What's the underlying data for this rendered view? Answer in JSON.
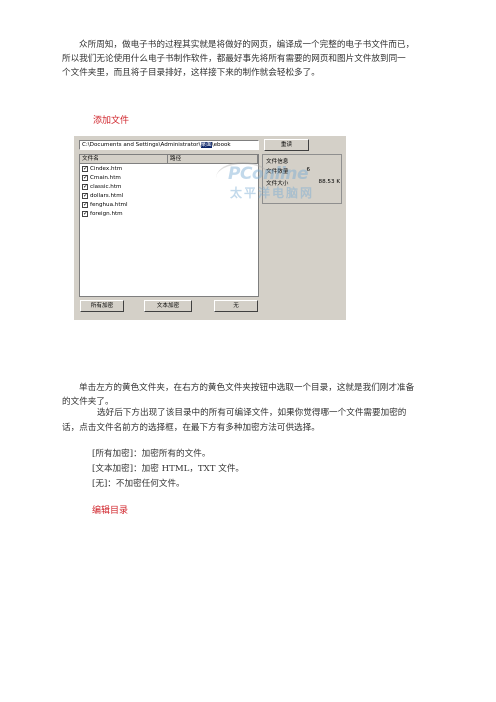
{
  "intro": {
    "lines": [
      "众所周知，做电子书的过程其实就是将做好的网页，编译成一个完整的电子书文件而已，",
      "所以我们无论使用什么电子书制作软件，都最好事先将所有需要的网页和图片文件放到同一",
      "个文件夹里，而且将子目录排好，这样接下来的制作就会轻松多了。"
    ]
  },
  "section1_heading": "添加文件",
  "screenshot": {
    "path_prefix": "C:\\Documents and Settings\\Administrator\\",
    "path_highlight": "桌面",
    "path_suffix": "\\ebook",
    "browse_button": "重读",
    "columns": {
      "name": "文件名",
      "path": "路径"
    },
    "files": [
      "Cindex.htm",
      "Cmain.htm",
      "classic.htm",
      "dollars.html",
      "fenghua.html",
      "foreign.htm"
    ],
    "info": {
      "title": "文件信息",
      "count_label": "文件数量",
      "count_value": "6",
      "size_label": "文件大小",
      "size_value": "88.53 K"
    },
    "buttons": {
      "all": "所有加密",
      "text": "文本加密",
      "none": "无"
    },
    "watermark": {
      "brand": "PConline",
      "cn": "太平洋电脑网"
    }
  },
  "para2": {
    "lines": [
      "单击左方的黄色文件夹，在右方的黄色文件夹按钮中选取一个目录，这就是我们刚才准备",
      "的文件夹了。"
    ]
  },
  "para3": {
    "lines": [
      "选好后下方出现了该目录中的所有可编译文件，如果你觉得哪一个文件需要加密的",
      "话，点击文件名前方的选择框，在最下方有多种加密方法可供选择。"
    ]
  },
  "options": [
    "[所有加密]：加密所有的文件。",
    "[文本加密]：加密 HTML，TXT 文件。",
    "[无]：不加密任何文件。"
  ],
  "section2_heading": "编辑目录"
}
